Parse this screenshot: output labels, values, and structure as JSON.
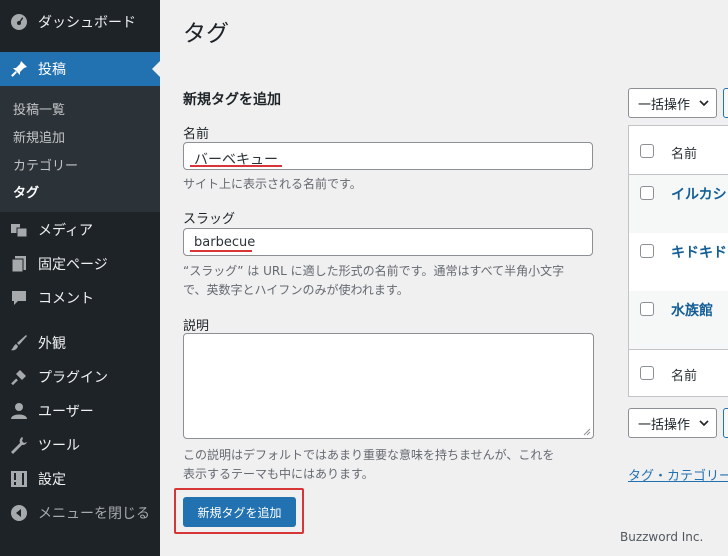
{
  "sidebar": {
    "items": [
      {
        "label": "ダッシュボード",
        "icon": "dashboard-icon"
      },
      {
        "label": "投稿",
        "icon": "pin-icon",
        "active": true
      },
      {
        "label": "メディア",
        "icon": "media-icon"
      },
      {
        "label": "固定ページ",
        "icon": "page-icon"
      },
      {
        "label": "コメント",
        "icon": "comment-icon"
      },
      {
        "label": "外観",
        "icon": "brush-icon"
      },
      {
        "label": "プラグイン",
        "icon": "plug-icon"
      },
      {
        "label": "ユーザー",
        "icon": "user-icon"
      },
      {
        "label": "ツール",
        "icon": "wrench-icon"
      },
      {
        "label": "設定",
        "icon": "settings-icon"
      },
      {
        "label": "メニューを閉じる",
        "icon": "collapse-icon"
      }
    ],
    "submenu": [
      "投稿一覧",
      "新規追加",
      "カテゴリー",
      "タグ"
    ]
  },
  "page": {
    "title": "タグ",
    "form_title": "新規タグを追加",
    "name_label": "名前",
    "name_value": "バーベキュー",
    "name_desc": "サイト上に表示される名前です。",
    "slug_label": "スラッグ",
    "slug_value": "barbecue",
    "slug_desc_1": "“スラッグ” は URL に適した形式の名前です。通常はすべて半角小文字",
    "slug_desc_2": "で、英数字とハイフンのみが使われます。",
    "desc_label": "説明",
    "desc_value": "",
    "desc_help_1": "この説明はデフォルトではあまり重要な意味を持ちませんが、これを",
    "desc_help_2": "表示するテーマも中にはあります。",
    "submit_label": "新規タグを追加"
  },
  "list": {
    "bulk_label": "一括操作",
    "header_name": "名前",
    "rows": [
      "イルカシ",
      "キドキド",
      "水族館"
    ],
    "footer_name": "名前",
    "bottom_link": "タグ・カテゴリー"
  },
  "watermark": "Buzzword Inc.",
  "colors": {
    "accent": "#2271b1",
    "highlight": "#d63638",
    "sidebar": "#1d2327"
  }
}
